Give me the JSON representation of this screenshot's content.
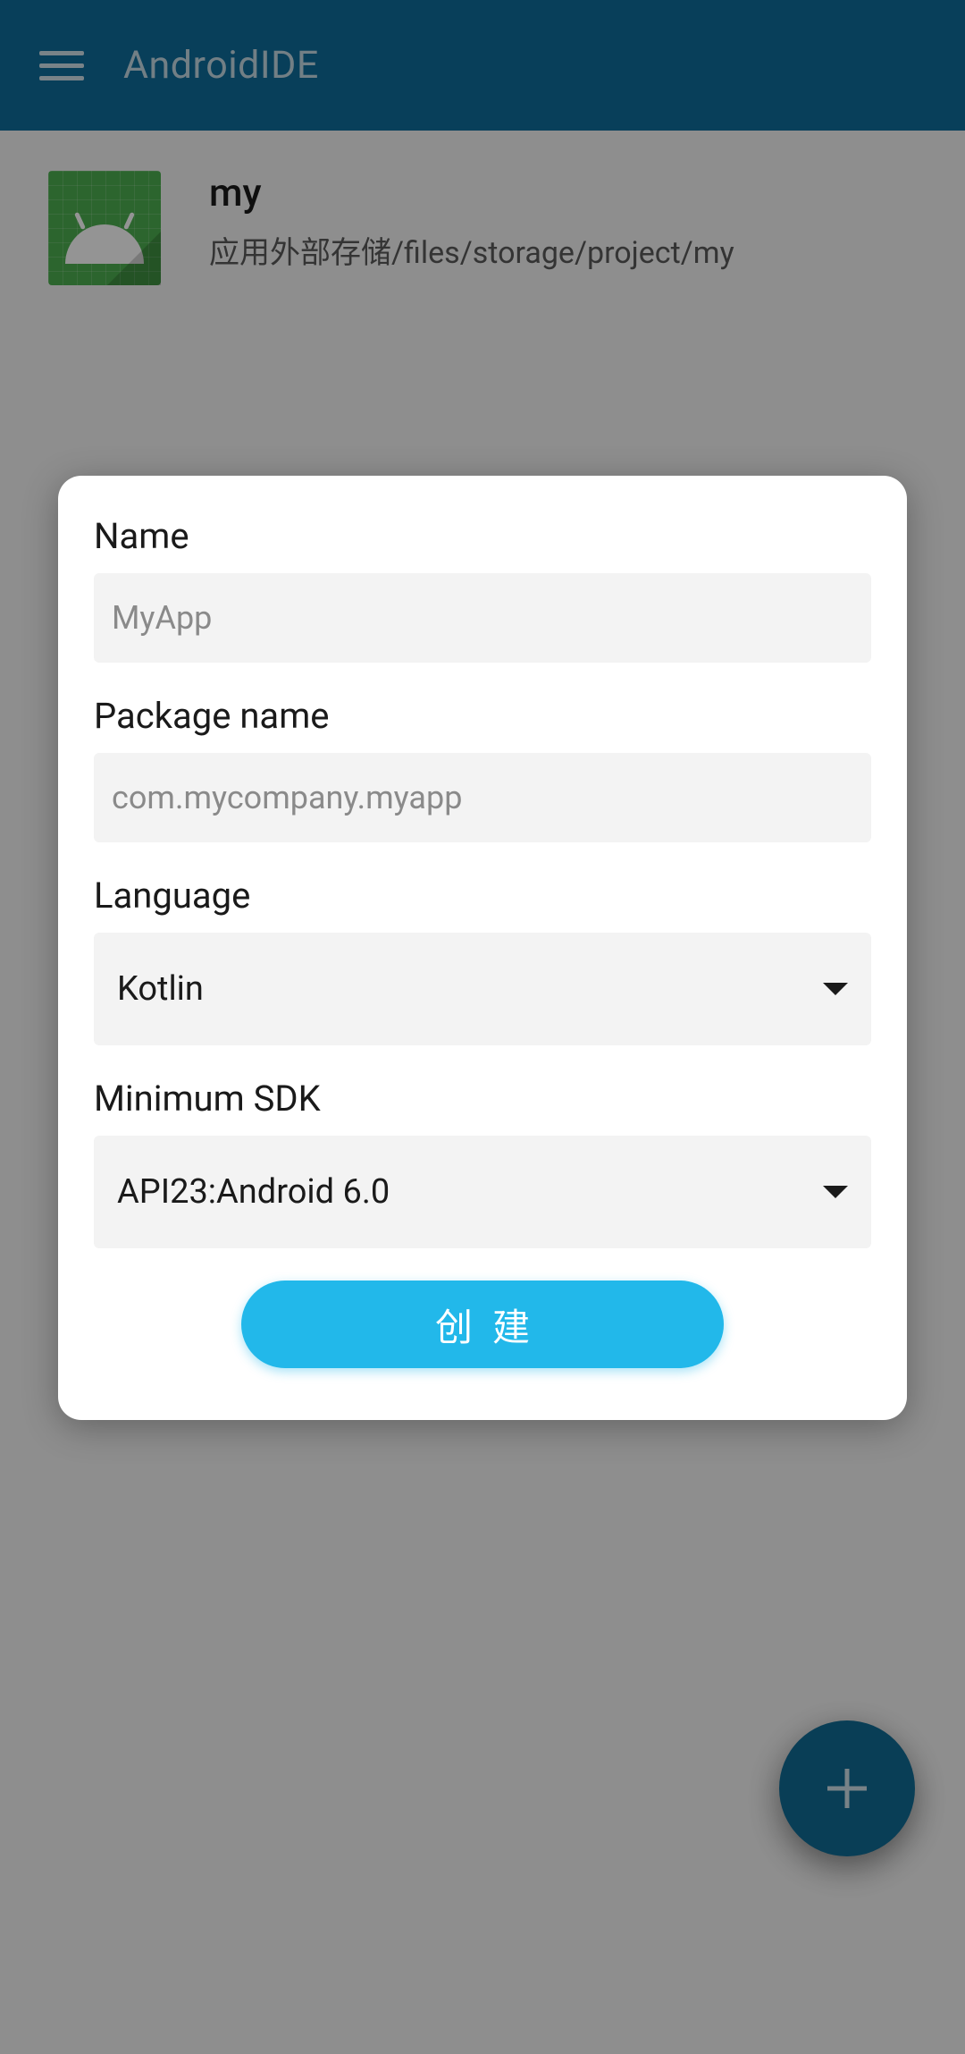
{
  "header": {
    "title": "AndroidIDE"
  },
  "project": {
    "name": "my",
    "path": "应用外部存储/files/storage/project/my"
  },
  "dialog": {
    "name_label": "Name",
    "name_placeholder": "MyApp",
    "package_label": "Package name",
    "package_placeholder": "com.mycompany.myapp",
    "language_label": "Language",
    "language_value": "Kotlin",
    "sdk_label": "Minimum SDK",
    "sdk_value": "API23:Android 6.0",
    "create_button": "创建"
  }
}
